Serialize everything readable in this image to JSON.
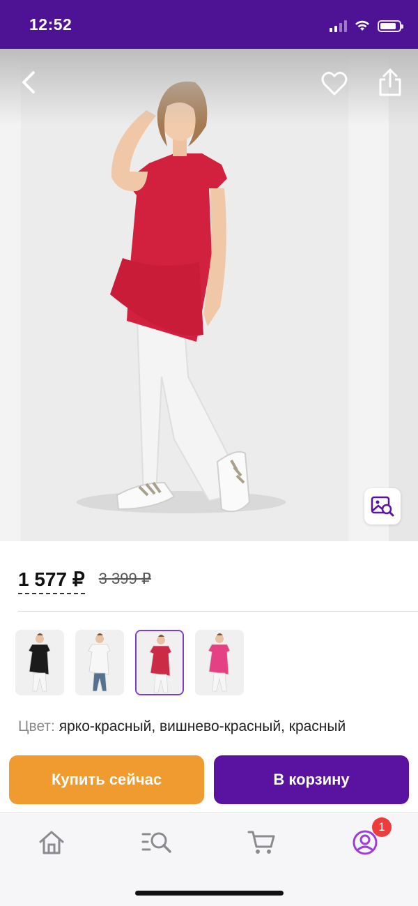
{
  "status_bar": {
    "time": "12:52",
    "battery_level": 0.85,
    "signal_bars": 2
  },
  "product": {
    "price_current": "1 577 ₽",
    "price_old": "3 399 ₽",
    "thumbnails": [
      {
        "color": "#1b1b1b",
        "selected": false
      },
      {
        "color": "#f7f7f7",
        "selected": false
      },
      {
        "color": "#cc2b45",
        "selected": true
      },
      {
        "color": "#e64084",
        "selected": false
      }
    ],
    "color_label": "Цвет:",
    "color_value": "ярко-красный, вишнево-красный, красный"
  },
  "actions": {
    "buy_now": "Купить сейчас",
    "add_to_cart": "В корзину"
  },
  "tab_bar": {
    "items": [
      "home-icon",
      "catalog-search-icon",
      "cart-icon",
      "profile-icon"
    ],
    "profile_badge": "1"
  },
  "colors": {
    "brand_purple": "#4e1294",
    "button_purple": "#5a12a0",
    "buy_orange": "#f09b2f",
    "badge_red": "#ee3b3b"
  }
}
